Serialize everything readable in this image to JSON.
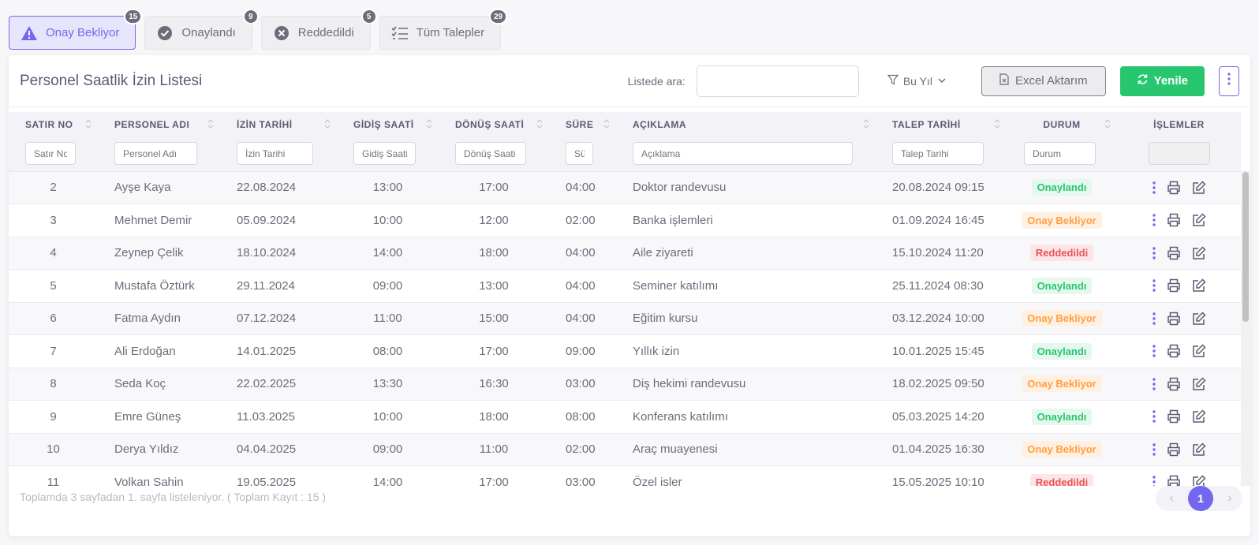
{
  "tabs": [
    {
      "label": "Onay Bekliyor",
      "badge": "15",
      "icon": "warning-triangle-icon"
    },
    {
      "label": "Onaylandı",
      "badge": "9",
      "icon": "check-circle-icon"
    },
    {
      "label": "Reddedildi",
      "badge": "5",
      "icon": "x-circle-icon"
    },
    {
      "label": "Tüm Talepler",
      "badge": "29",
      "icon": "list-check-icon"
    }
  ],
  "header": {
    "title": "Personel Saatlik İzin Listesi",
    "search_label": "Listede ara:",
    "search_value": "",
    "year_filter": "Bu Yıl",
    "excel_label": "Excel Aktarım",
    "refresh_label": "Yenile"
  },
  "table": {
    "columns": [
      "SATIR NO",
      "PERSONEL ADI",
      "İZİN TARİHİ",
      "GİDİŞ SAATİ",
      "DÖNÜŞ SAATİ",
      "SÜRE",
      "AÇIKLAMA",
      "TALEP TARİHİ",
      "DURUM",
      "İŞLEMLER"
    ],
    "filter_placeholders": [
      "Satır No",
      "Personel Adı",
      "İzin Tarihi",
      "Gidiş Saati",
      "Dönüş Saati",
      "Süre",
      "Açıklama",
      "Talep Tarihi",
      "Durum"
    ],
    "rows": [
      {
        "no": "2",
        "name": "Ayşe Kaya",
        "date": "22.08.2024",
        "out": "13:00",
        "back": "17:00",
        "dur": "04:00",
        "desc": "Doktor randevusu",
        "req": "20.08.2024 09:15",
        "status": "Onaylandı"
      },
      {
        "no": "3",
        "name": "Mehmet Demir",
        "date": "05.09.2024",
        "out": "10:00",
        "back": "12:00",
        "dur": "02:00",
        "desc": "Banka işlemleri",
        "req": "01.09.2024 16:45",
        "status": "Onay Bekliyor"
      },
      {
        "no": "4",
        "name": "Zeynep Çelik",
        "date": "18.10.2024",
        "out": "14:00",
        "back": "18:00",
        "dur": "04:00",
        "desc": "Aile ziyareti",
        "req": "15.10.2024 11:20",
        "status": "Reddedildi"
      },
      {
        "no": "5",
        "name": "Mustafa Öztürk",
        "date": "29.11.2024",
        "out": "09:00",
        "back": "13:00",
        "dur": "04:00",
        "desc": "Seminer katılımı",
        "req": "25.11.2024 08:30",
        "status": "Onaylandı"
      },
      {
        "no": "6",
        "name": "Fatma Aydın",
        "date": "07.12.2024",
        "out": "11:00",
        "back": "15:00",
        "dur": "04:00",
        "desc": "Eğitim kursu",
        "req": "03.12.2024 10:00",
        "status": "Onay Bekliyor"
      },
      {
        "no": "7",
        "name": "Ali Erdoğan",
        "date": "14.01.2025",
        "out": "08:00",
        "back": "17:00",
        "dur": "09:00",
        "desc": "Yıllık izin",
        "req": "10.01.2025 15:45",
        "status": "Onaylandı"
      },
      {
        "no": "8",
        "name": "Seda Koç",
        "date": "22.02.2025",
        "out": "13:30",
        "back": "16:30",
        "dur": "03:00",
        "desc": "Diş hekimi randevusu",
        "req": "18.02.2025 09:50",
        "status": "Onay Bekliyor"
      },
      {
        "no": "9",
        "name": "Emre Güneş",
        "date": "11.03.2025",
        "out": "10:00",
        "back": "18:00",
        "dur": "08:00",
        "desc": "Konferans katılımı",
        "req": "05.03.2025 14:20",
        "status": "Onaylandı"
      },
      {
        "no": "10",
        "name": "Derya Yıldız",
        "date": "04.04.2025",
        "out": "09:00",
        "back": "11:00",
        "dur": "02:00",
        "desc": "Araç muayenesi",
        "req": "01.04.2025 16:30",
        "status": "Onay Bekliyor"
      },
      {
        "no": "11",
        "name": "Volkan Şahin",
        "date": "19.05.2025",
        "out": "14:00",
        "back": "17:00",
        "dur": "03:00",
        "desc": "Özel işler",
        "req": "15.05.2025 10:10",
        "status": "Reddedildi"
      }
    ]
  },
  "footer": {
    "summary": "Toplamda 3 sayfadan 1. sayfa listeleniyor. ( Toplam Kayıt : 15 )",
    "current_page": "1"
  },
  "colors": {
    "primary": "#7367f0",
    "success": "#28c76f",
    "warning": "#ff9f43",
    "danger": "#ea5455"
  }
}
